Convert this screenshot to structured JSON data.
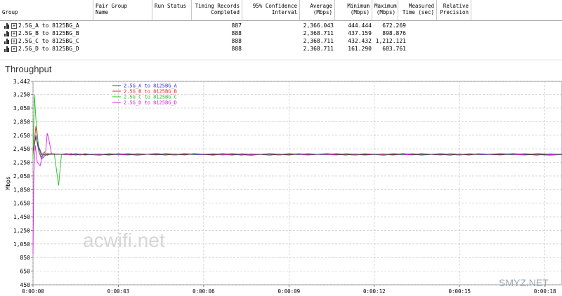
{
  "table": {
    "columns": [
      "Group",
      "Pair Group\nName",
      "Run Status",
      "Timing Records\nCompleted",
      "95% Confidence\nInterval",
      "Average\n(Mbps)",
      "Minimum\n(Mbps)",
      "Maximum\n(Mbps)",
      "Measured\nTime (sec)",
      "Relative\nPrecision"
    ],
    "rows": [
      {
        "group": "2.5G_A to 8125BG_A",
        "pair_group": "",
        "run_status": "",
        "records": "887",
        "ci": "",
        "average": "2,366.043",
        "minimum": "444.444",
        "maximum": "672.269",
        "measured": "",
        "precision": ""
      },
      {
        "group": "2.5G_B to 8125BG_B",
        "pair_group": "",
        "run_status": "",
        "records": "888",
        "ci": "",
        "average": "2,368.711",
        "minimum": "437.159",
        "maximum": "898.876",
        "measured": "",
        "precision": ""
      },
      {
        "group": "2.5G_C to 8125BG_C",
        "pair_group": "",
        "run_status": "",
        "records": "888",
        "ci": "",
        "average": "2,368.711",
        "minimum": "432.432",
        "maximum": "1,212.121",
        "measured": "",
        "precision": ""
      },
      {
        "group": "2.5G_D to 8125BG_D",
        "pair_group": "",
        "run_status": "",
        "records": "888",
        "ci": "",
        "average": "2,368.711",
        "minimum": "161.290",
        "maximum": "683.761",
        "measured": "",
        "precision": ""
      }
    ]
  },
  "chart_data": {
    "type": "line",
    "title": "Throughput",
    "ylabel": "Mbps",
    "xlabel": "",
    "ylim": [
      450,
      3442
    ],
    "xlim": [
      0,
      18.6
    ],
    "y_ticks": [
      "3,442",
      "3,250",
      "3,050",
      "2,850",
      "2,650",
      "2,450",
      "2,250",
      "2,050",
      "1,850",
      "1,650",
      "1,450",
      "1,250",
      "1,050",
      "850",
      "650",
      "450"
    ],
    "y_tick_values": [
      3442,
      3250,
      3050,
      2850,
      2650,
      2450,
      2250,
      2050,
      1850,
      1650,
      1450,
      1250,
      1050,
      850,
      650,
      450
    ],
    "x_ticks": [
      "0:00:00",
      "0:00:03",
      "0:00:06",
      "0:00:09",
      "0:00:12",
      "0:00:15",
      "0:00:18"
    ],
    "x_tick_values": [
      0,
      3,
      6,
      9,
      12,
      15,
      18
    ],
    "grid": true,
    "legend_position": "top-left",
    "series": [
      {
        "name": "2.5G_A to 8125BG_A",
        "color": "#3030ff",
        "x": [
          0,
          0.1,
          0.2,
          0.3,
          0.45,
          0.6,
          1.0,
          2.0,
          4.0,
          6.0,
          8.0,
          10.0,
          12.0,
          14.0,
          16.0,
          18.6
        ],
        "y": [
          2380,
          2650,
          2420,
          2300,
          2360,
          2370,
          2368,
          2366,
          2369,
          2365,
          2368,
          2367,
          2366,
          2368,
          2366,
          2366
        ]
      },
      {
        "name": "2.5G_B to 8125BG_B",
        "color": "#ff2020",
        "x": [
          0,
          0.1,
          0.2,
          0.3,
          0.45,
          0.6,
          1.0,
          2.0,
          4.0,
          6.0,
          8.0,
          10.0,
          12.0,
          14.0,
          16.0,
          18.6
        ],
        "y": [
          2350,
          2780,
          2480,
          2330,
          2390,
          2372,
          2369,
          2368,
          2370,
          2367,
          2369,
          2368,
          2369,
          2368,
          2370,
          2369
        ]
      },
      {
        "name": "2.5G_C to 8125BG_C",
        "color": "#20c020",
        "x": [
          0,
          0.05,
          0.1,
          0.2,
          0.3,
          0.4,
          0.5,
          0.6,
          0.75,
          0.9,
          1.0,
          2.0,
          4.0,
          6.0,
          8.0,
          10.0,
          12.0,
          14.0,
          16.0,
          18.6
        ],
        "y": [
          2300,
          3250,
          2900,
          2450,
          2360,
          2400,
          2350,
          2380,
          2370,
          1910,
          2368,
          2369,
          2368,
          2369,
          2368,
          2369,
          2368,
          2369,
          2368,
          2369
        ]
      },
      {
        "name": "2.5G_D to 8125BG_D",
        "color": "#e020e0",
        "x": [
          0,
          0.03,
          0.08,
          0.15,
          0.25,
          0.35,
          0.45,
          0.5,
          0.55,
          0.65,
          0.8,
          1.0,
          2.0,
          4.0,
          6.0,
          8.0,
          10.0,
          12.0,
          14.0,
          16.0,
          18.6
        ],
        "y": [
          900,
          2100,
          2500,
          2250,
          2200,
          2380,
          2420,
          2680,
          2600,
          2380,
          2375,
          2369,
          2368,
          2370,
          2367,
          2369,
          2368,
          2370,
          2368,
          2369,
          2369
        ]
      },
      {
        "name": "",
        "color": "#404040",
        "x": [
          0,
          0.1,
          0.2,
          0.3,
          0.4,
          0.6,
          1.0,
          2.0,
          4.0,
          6.0,
          8.0,
          10.0,
          12.0,
          14.0,
          16.0,
          18.6
        ],
        "y": [
          2420,
          2620,
          2480,
          2380,
          2360,
          2368,
          2368,
          2367,
          2368,
          2368,
          2367,
          2368,
          2368,
          2367,
          2368,
          2368
        ]
      }
    ]
  },
  "watermarks": {
    "center": "acwifi.net",
    "corner": "SMYZ.NET"
  }
}
